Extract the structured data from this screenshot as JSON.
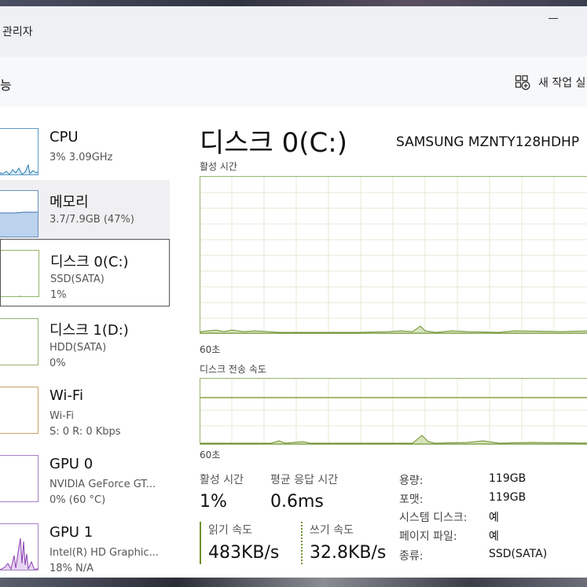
{
  "window": {
    "title": "관리자"
  },
  "toolbar": {
    "section_title": "능",
    "new_task_label": "새 작업 실",
    "new_task_icon": "new-task-icon"
  },
  "sidebar": {
    "items": [
      {
        "name": "CPU",
        "sub1": "3%  3.09GHz",
        "sub2": ""
      },
      {
        "name": "메모리",
        "sub1": "3.7/7.9GB (47%)",
        "sub2": ""
      },
      {
        "name": "디스크 0(C:)",
        "sub1": "SSD(SATA)",
        "sub2": "1%"
      },
      {
        "name": "디스크 1(D:)",
        "sub1": "HDD(SATA)",
        "sub2": "0%"
      },
      {
        "name": "Wi-Fi",
        "sub1": "Wi-Fi",
        "sub2": "S: 0  R: 0 Kbps"
      },
      {
        "name": "GPU 0",
        "sub1": "NVIDIA GeForce GT...",
        "sub2": "0%  (60 °C)"
      },
      {
        "name": "GPU 1",
        "sub1": "Intel(R) HD Graphic...",
        "sub2": "18%  N/A"
      }
    ]
  },
  "main": {
    "title": "디스크 0(C:)",
    "model": "SAMSUNG MZNTY128HDHP",
    "chart1_label": "활성 시간",
    "chart1_time": "60초",
    "chart2_label": "디스크 전송 속도",
    "chart2_time": "60초",
    "stats": {
      "active_label": "활성 시간",
      "active_value": "1%",
      "resp_label": "평균 응답 시간",
      "resp_value": "0.6ms",
      "read_label": "읽기 속도",
      "read_value": "483KB/s",
      "write_label": "쓰기 속도",
      "write_value": "32.8KB/s"
    },
    "props": [
      {
        "k": "용량:",
        "v": "119GB"
      },
      {
        "k": "포맷:",
        "v": "119GB"
      },
      {
        "k": "시스템 디스크:",
        "v": "예"
      },
      {
        "k": "페이지 파일:",
        "v": "예"
      },
      {
        "k": "종류:",
        "v": "SSD(SATA)"
      }
    ]
  },
  "colors": {
    "accent_disk": "#6f8f2c",
    "accent_cpu": "#2f7fb0",
    "accent_gpu": "#8a3fb0"
  }
}
